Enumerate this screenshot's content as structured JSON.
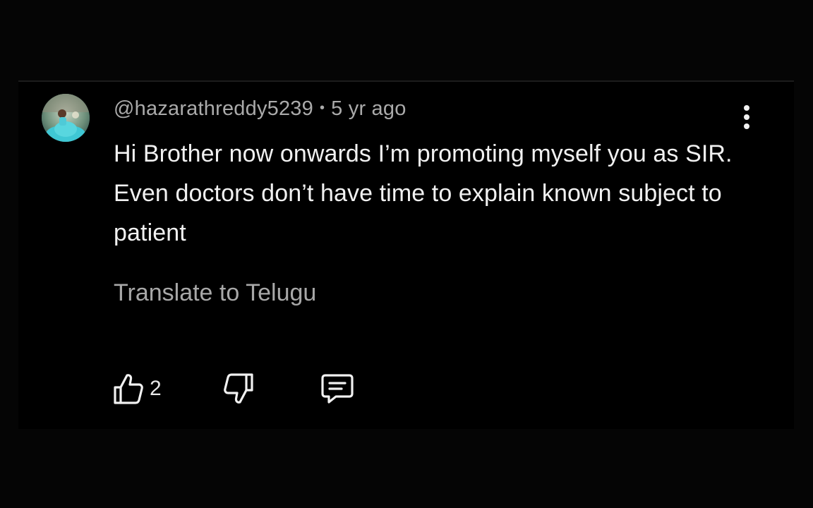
{
  "comment": {
    "author": "@hazarathreddy5239",
    "separator": "•",
    "timestamp": "5 yr ago",
    "text": "Hi Brother now onwards I’m promoting myself you as SIR. Even doctors don’t have time to explain known subject to patient",
    "translate_label": "Translate to Telugu",
    "like_count": "2",
    "icons": {
      "menu": "more-vertical-icon",
      "like": "thumbs-up-icon",
      "dislike": "thumbs-down-icon",
      "reply": "comment-reply-icon"
    }
  },
  "colors": {
    "background": "#050505",
    "card": "#000000",
    "text_primary": "#f1f1f1",
    "text_secondary": "#aaaaaa"
  }
}
